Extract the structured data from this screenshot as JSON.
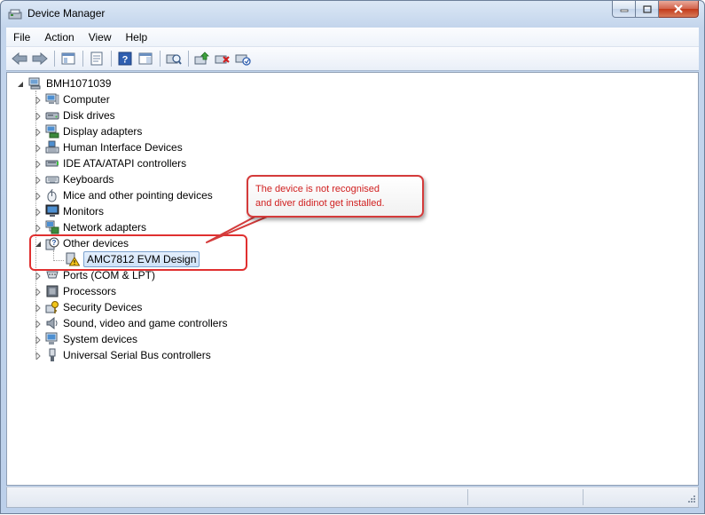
{
  "window": {
    "title": "Device Manager"
  },
  "menu": [
    "File",
    "Action",
    "View",
    "Help"
  ],
  "toolbar": {
    "buttons": [
      "back-arrow-icon",
      "forward-arrow-icon",
      "show-hide-tree-icon",
      "properties-icon",
      "help-icon",
      "action-pane-icon",
      "scan-hardware-icon",
      "update-driver-icon",
      "uninstall-icon",
      "disable-icon"
    ]
  },
  "tree": {
    "root": "BMH1071039",
    "items": [
      {
        "label": "Computer",
        "icon": "computer-icon"
      },
      {
        "label": "Disk drives",
        "icon": "disk-drive-icon"
      },
      {
        "label": "Display adapters",
        "icon": "display-adapter-icon"
      },
      {
        "label": "Human Interface Devices",
        "icon": "hid-icon"
      },
      {
        "label": "IDE ATA/ATAPI controllers",
        "icon": "ide-controller-icon"
      },
      {
        "label": "Keyboards",
        "icon": "keyboard-icon"
      },
      {
        "label": "Mice and other pointing devices",
        "icon": "mouse-icon"
      },
      {
        "label": "Monitors",
        "icon": "monitor-icon"
      },
      {
        "label": "Network adapters",
        "icon": "network-adapter-icon"
      },
      {
        "label": "Other devices",
        "icon": "unknown-device-icon"
      },
      {
        "label": "AMC7812 EVM Design",
        "icon": "warning-device-icon"
      },
      {
        "label": "Ports (COM & LPT)",
        "icon": "port-icon"
      },
      {
        "label": "Processors",
        "icon": "processor-icon"
      },
      {
        "label": "Security Devices",
        "icon": "security-device-icon"
      },
      {
        "label": "Sound, video and game controllers",
        "icon": "sound-icon"
      },
      {
        "label": "System devices",
        "icon": "system-device-icon"
      },
      {
        "label": "Universal Serial Bus controllers",
        "icon": "usb-icon"
      }
    ]
  },
  "callout": {
    "line1": "The device is not recognised",
    "line2": "and diver didinot get installed."
  },
  "colors": {
    "annotation": "#e03030",
    "callout_text": "#d01f1f",
    "selection": "#cfe2f8"
  }
}
